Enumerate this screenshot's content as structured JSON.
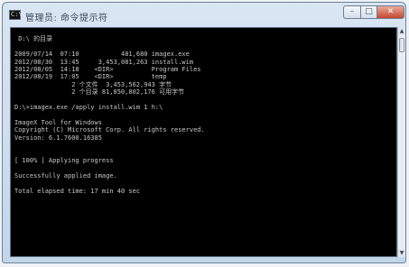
{
  "window": {
    "title": "管理员: 命令提示符",
    "icon_label": "C:\\",
    "controls": {
      "minimize": "–",
      "maximize": "□",
      "close": "✕"
    }
  },
  "console": {
    "lines": [
      "",
      " D:\\ 的目录",
      "",
      "2009/07/14  07:10           481,680 imagex.exe",
      "2012/08/30  13:45     3,453,081,263 install.wim",
      "2012/08/05  14:18    <DIR>          Program Files",
      "2012/08/19  17:05    <DIR>          temp",
      "               2 个文件  3,453,562,943 字节",
      "               2 个目录 81,850,802,176 可用字节",
      "",
      "D:\\>imagex.exe /apply install.wim 1 h:\\",
      "",
      "ImageX Tool for Windows",
      "Copyright (C) Microsoft Corp. All rights reserved.",
      "Version: 6.1.7600.16385",
      "",
      "",
      "[ 100% ] Applying progress",
      "",
      "Successfully applied image.",
      "",
      "Total elapsed time: 17 min 40 sec"
    ]
  },
  "scrollbar": {
    "up": "▲",
    "down": "▼"
  }
}
